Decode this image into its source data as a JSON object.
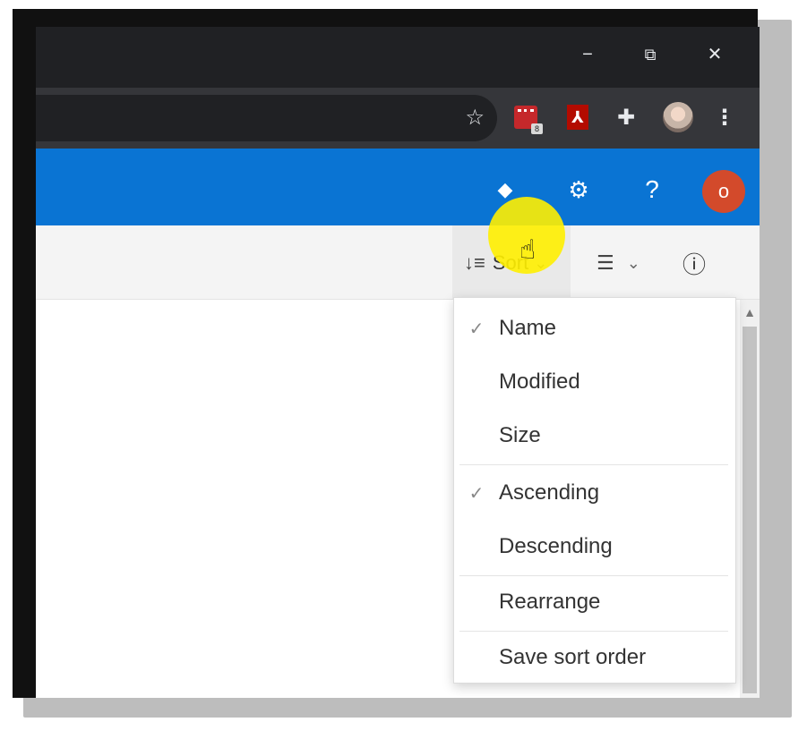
{
  "window": {
    "minimize_glyph": "−",
    "restore_glyph": "⧉",
    "close_glyph": "✕"
  },
  "toolbar": {
    "bookmark_glyph": "☆",
    "extension_badge": "8",
    "pdf_glyph": "⅄",
    "puzzle_glyph": "✚",
    "menu_glyph": "⋮"
  },
  "appbar": {
    "accent": "#0a74d3",
    "premium_glyph": "◆",
    "settings_glyph": "⚙",
    "help_glyph": "?",
    "avatar_glyph": "o"
  },
  "commandbar": {
    "sort_glyph": "↓≡",
    "sort_label": "Sort",
    "chevron": "⌄",
    "view_glyph": "☰",
    "info_glyph": "ⓘ"
  },
  "sort_menu": {
    "check_glyph": "✓",
    "items": [
      {
        "label": "Name",
        "checked": true
      },
      {
        "label": "Modified",
        "checked": false
      },
      {
        "label": "Size",
        "checked": false
      }
    ],
    "order": [
      {
        "label": "Ascending",
        "checked": true
      },
      {
        "label": "Descending",
        "checked": false
      }
    ],
    "actions": [
      {
        "label": "Rearrange"
      },
      {
        "label": "Save sort order"
      }
    ]
  },
  "scrollbar": {
    "up_glyph": "▲"
  }
}
